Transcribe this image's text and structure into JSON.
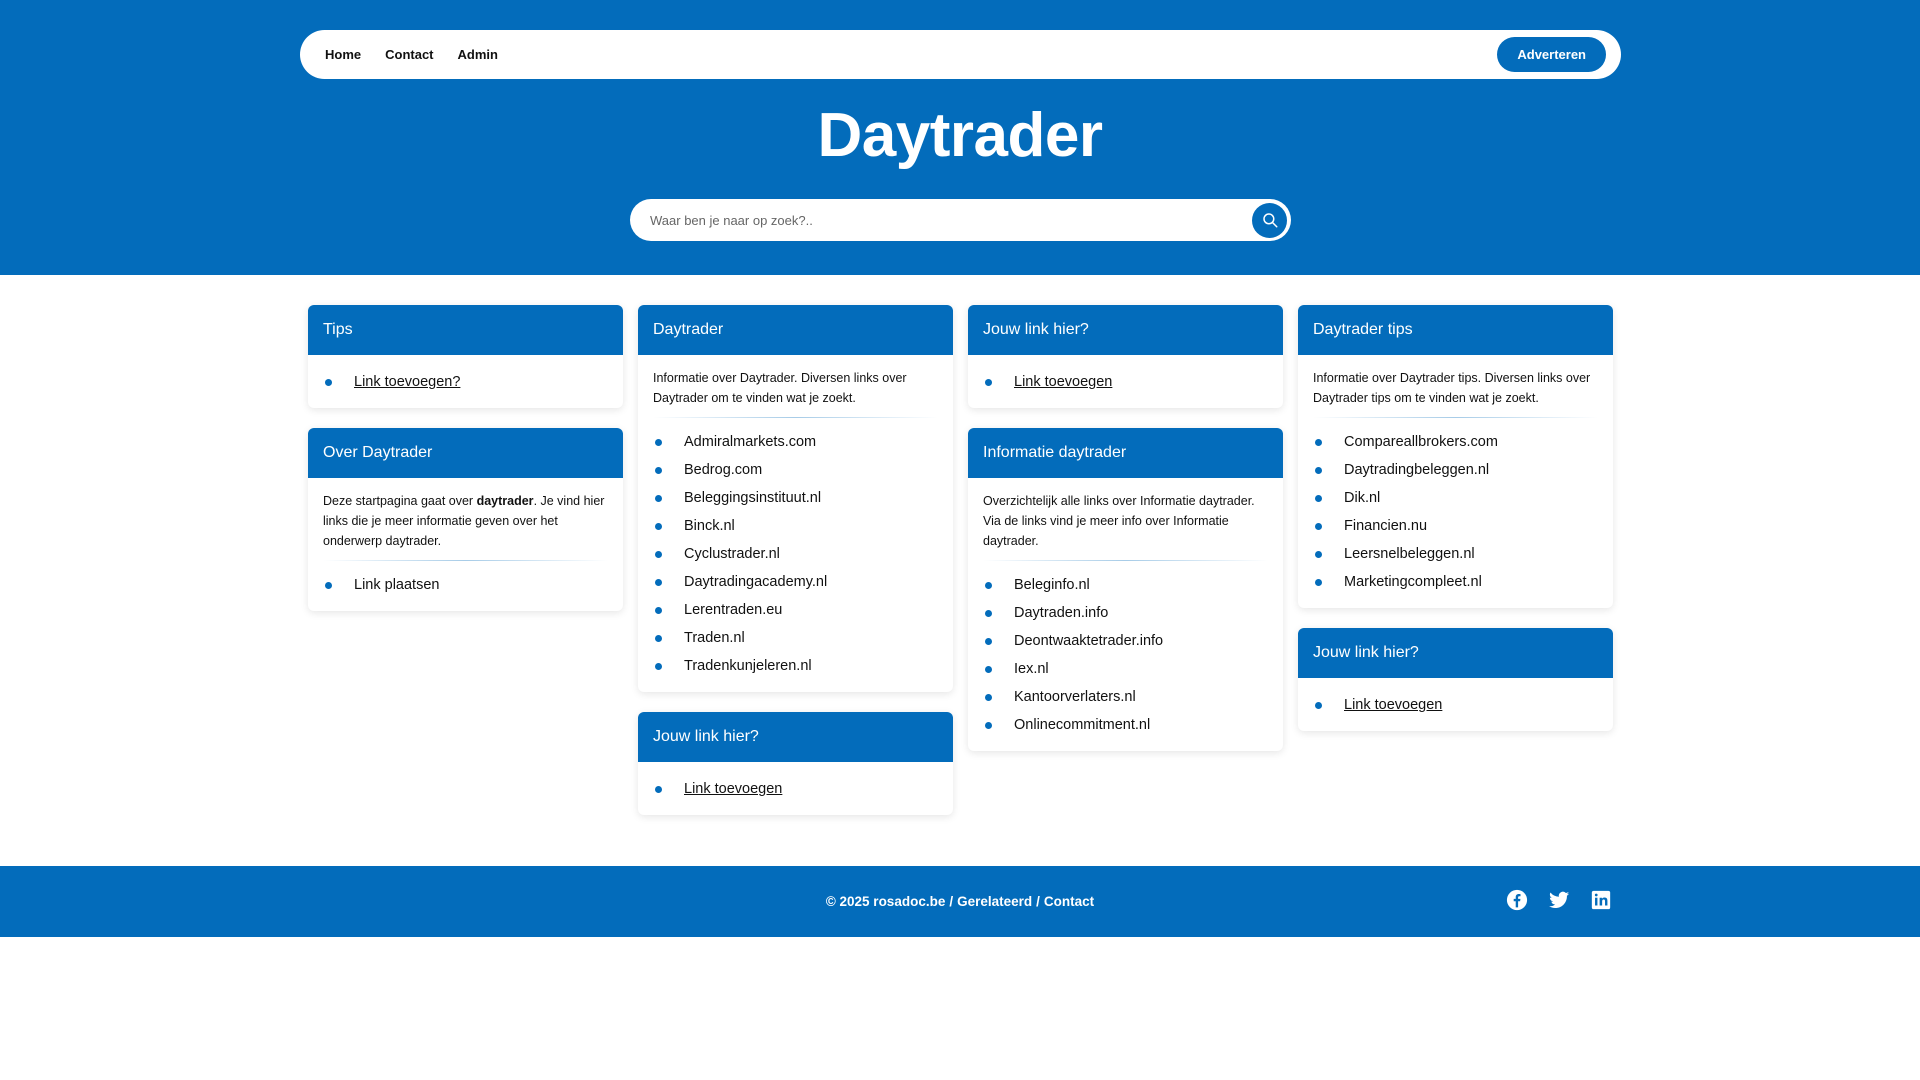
{
  "nav": {
    "items": [
      "Home",
      "Contact",
      "Admin"
    ],
    "cta": "Adverteren"
  },
  "site_title": "Daytrader",
  "search": {
    "placeholder": "Waar ben je naar op zoek?.."
  },
  "cards": {
    "tips": {
      "title": "Tips",
      "links": [
        "Link toevoegen?"
      ]
    },
    "over": {
      "title": "Over Daytrader",
      "desc_pre": "Deze startpagina gaat over ",
      "desc_bold": "daytrader",
      "desc_post": ". Je vind hier links die je meer informatie geven over het onderwerp daytrader.",
      "links": [
        "Link plaatsen"
      ]
    },
    "daytrader": {
      "title": "Daytrader",
      "desc": "Informatie over Daytrader. Diversen links over Daytrader om te vinden wat je zoekt.",
      "links": [
        "Admiralmarkets.com",
        "Bedrog.com",
        "Beleggingsinstituut.nl",
        "Binck.nl",
        "Cyclustrader.nl",
        "Daytradingacademy.nl",
        "Lerentraden.eu",
        "Traden.nl",
        "Tradenkunjeleren.nl"
      ]
    },
    "jouw1": {
      "title": "Jouw link hier?",
      "links": [
        "Link toevoegen"
      ]
    },
    "jouw2": {
      "title": "Jouw link hier?",
      "links": [
        "Link toevoegen"
      ]
    },
    "informatie": {
      "title": "Informatie daytrader",
      "desc": "Overzichtelijk alle links over Informatie daytrader. Via de links vind je meer info over Informatie daytrader.",
      "links": [
        "Beleginfo.nl",
        "Daytraden.info",
        "Deontwaaktetrader.info",
        "Iex.nl",
        "Kantoorverlaters.nl",
        "Onlinecommitment.nl"
      ]
    },
    "tipsdt": {
      "title": "Daytrader tips",
      "desc": "Informatie over Daytrader tips. Diversen links over Daytrader tips om te vinden wat je zoekt.",
      "links": [
        "Compareallbrokers.com",
        "Daytradingbeleggen.nl",
        "Dik.nl",
        "Financien.nu",
        "Leersnelbeleggen.nl",
        "Marketingcompleet.nl"
      ]
    },
    "jouw3": {
      "title": "Jouw link hier?",
      "links": [
        "Link toevoegen"
      ]
    }
  },
  "footer": {
    "copyright": "© 2025 rosadoc.be",
    "sep": "/",
    "link1": "Gerelateerd",
    "link2": "Contact",
    "social": [
      "facebook-icon",
      "twitter-icon",
      "linkedin-icon"
    ]
  },
  "colors": {
    "brand": "#036cbb",
    "background": "#ffffff"
  }
}
